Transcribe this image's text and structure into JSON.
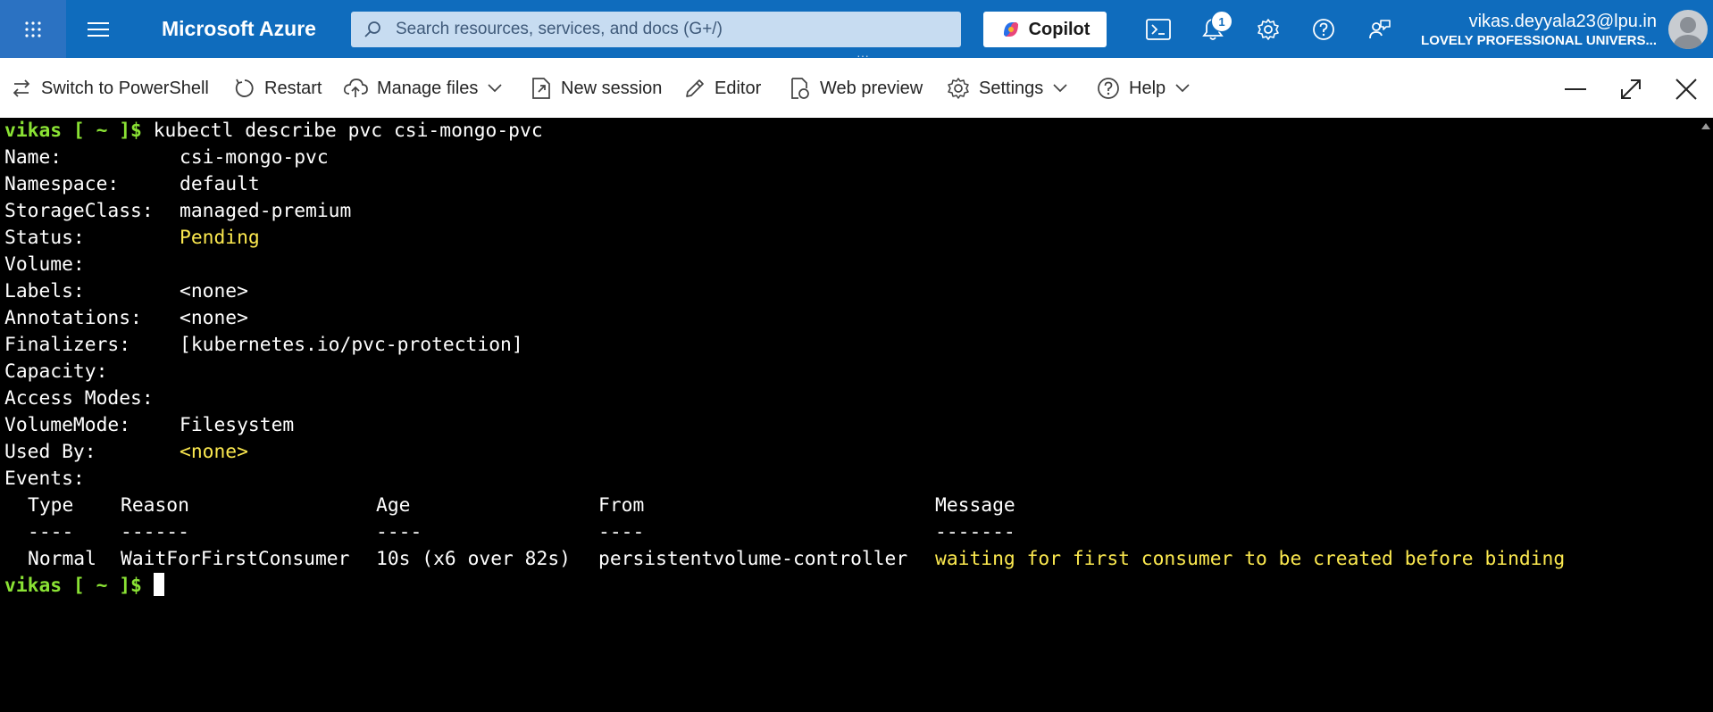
{
  "topbar": {
    "brand": "Microsoft Azure",
    "search_placeholder": "Search resources, services, and docs (G+/)",
    "copilot_label": "Copilot",
    "notification_count": "1",
    "user_email": "vikas.deyyala23@lpu.in",
    "user_org": "LOVELY PROFESSIONAL UNIVERS..."
  },
  "toolbar": {
    "switch": "Switch to PowerShell",
    "restart": "Restart",
    "manage_files": "Manage files",
    "new_session": "New session",
    "editor": "Editor",
    "web_preview": "Web preview",
    "settings": "Settings",
    "help": "Help"
  },
  "terminal": {
    "prompt": "vikas [ ~ ]$",
    "command": " kubectl describe pvc csi-mongo-pvc",
    "fields": [
      {
        "key": "Name:",
        "value": "csi-mongo-pvc",
        "highlight": false
      },
      {
        "key": "Namespace:",
        "value": "default",
        "highlight": false
      },
      {
        "key": "StorageClass:",
        "value": "managed-premium",
        "highlight": false
      },
      {
        "key": "Status:",
        "value": "Pending",
        "highlight": true
      },
      {
        "key": "Volume:",
        "value": "",
        "highlight": false
      },
      {
        "key": "Labels:",
        "value": "<none>",
        "highlight": false
      },
      {
        "key": "Annotations:",
        "value": "<none>",
        "highlight": false
      },
      {
        "key": "Finalizers:",
        "value": "[kubernetes.io/pvc-protection]",
        "highlight": false
      },
      {
        "key": "Capacity:",
        "value": "",
        "highlight": false
      },
      {
        "key": "Access Modes:",
        "value": "",
        "highlight": false
      },
      {
        "key": "VolumeMode:",
        "value": "Filesystem",
        "highlight": false
      },
      {
        "key": "Used By:",
        "value": "<none>",
        "highlight": true
      }
    ],
    "events_label": "Events:",
    "events_header": [
      "Type",
      "Reason",
      "Age",
      "From",
      "Message"
    ],
    "events_divider": [
      "----",
      "------",
      "----",
      "----",
      "-------"
    ],
    "events_row": {
      "type": "Normal",
      "reason": "WaitForFirstConsumer",
      "age": "10s (x6 over 82s)",
      "from": "persistentvolume-controller",
      "message": "waiting for first consumer to be created before binding"
    },
    "final_prompt": "vikas [ ~ ]$"
  },
  "colors": {
    "azure_blue": "#0f6cbd",
    "prompt_green": "#8ae234",
    "highlight_yellow": "#fce94f"
  }
}
